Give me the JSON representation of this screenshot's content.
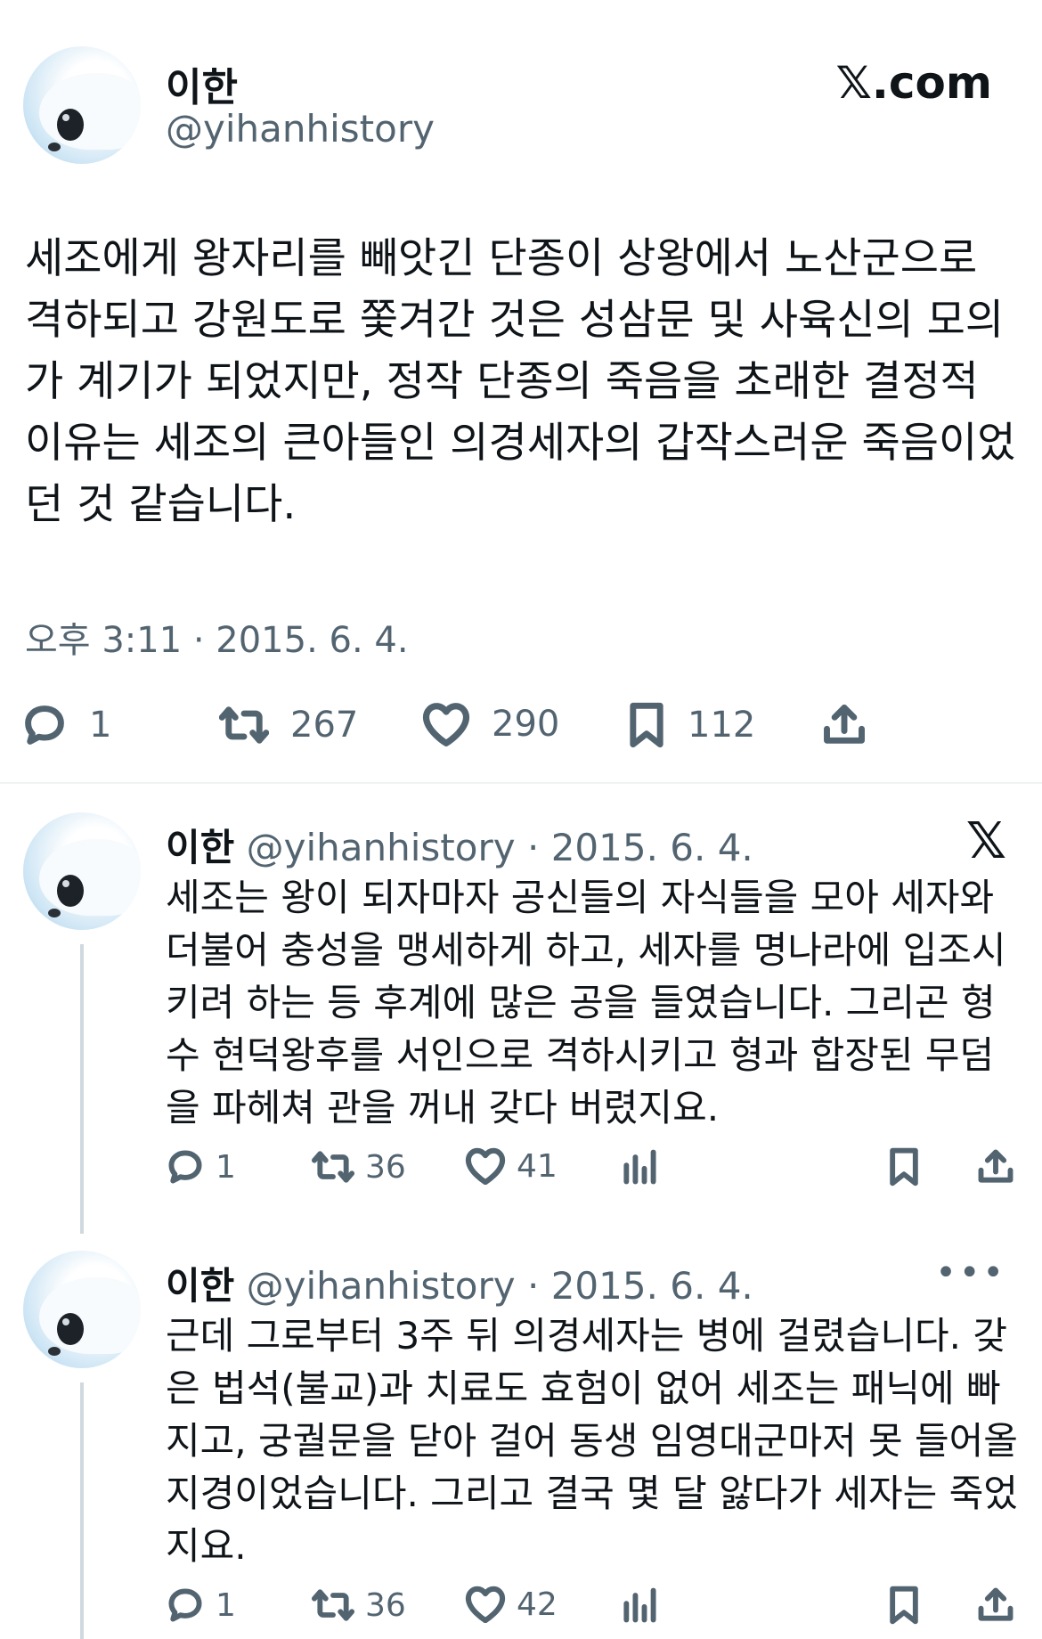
{
  "main": {
    "author_name": "이한",
    "author_handle": "@yihanhistory",
    "brand": "𝕏.com",
    "text": "세조에게 왕자리를 빼앗긴 단종이 상왕에서 노산군으로 격하되고 강원도로 쫓겨간 것은 성삼문 및 사육신의 모의가 계기가 되었지만, 정작 단종의 죽음을 초래한 결정적 이유는 세조의 큰아들인 의경세자의 갑작스러운 죽음이었던 것 같습니다.",
    "timestamp": "오후 3:11 · 2015. 6. 4.",
    "actions": {
      "replies": "1",
      "reposts": "267",
      "likes": "290",
      "bookmarks": "112"
    }
  },
  "replies": [
    {
      "name": "이한",
      "handle": "@yihanhistory",
      "dot": "·",
      "date": "2015. 6. 4.",
      "corner": "𝕏",
      "text": "세조는 왕이 되자마자 공신들의 자식들을 모아 세자와 더불어 충성을 맹세하게 하고, 세자를 명나라에 입조시키려 하는 등 후계에 많은 공을 들였습니다. 그리곤 형수 현덕왕후를 서인으로 격하시키고 형과 합장된 무덤을 파헤쳐 관을 꺼내 갖다 버렸지요.",
      "replies": "1",
      "reposts": "36",
      "likes": "41"
    },
    {
      "name": "이한",
      "handle": "@yihanhistory",
      "dot": "·",
      "date": "2015. 6. 4.",
      "corner": "•••",
      "text": "근데 그로부터 3주 뒤 의경세자는 병에 걸렸습니다. 갖은 법석(불교)과 치료도 효험이 없어 세조는 패닉에 빠지고, 궁궐문을 닫아 걸어 동생 임영대군마저 못 들어올 지경이었습니다. 그리고 결국 몇 달 앓다가 세자는 죽었지요.",
      "replies": "1",
      "reposts": "36",
      "likes": "42"
    }
  ]
}
